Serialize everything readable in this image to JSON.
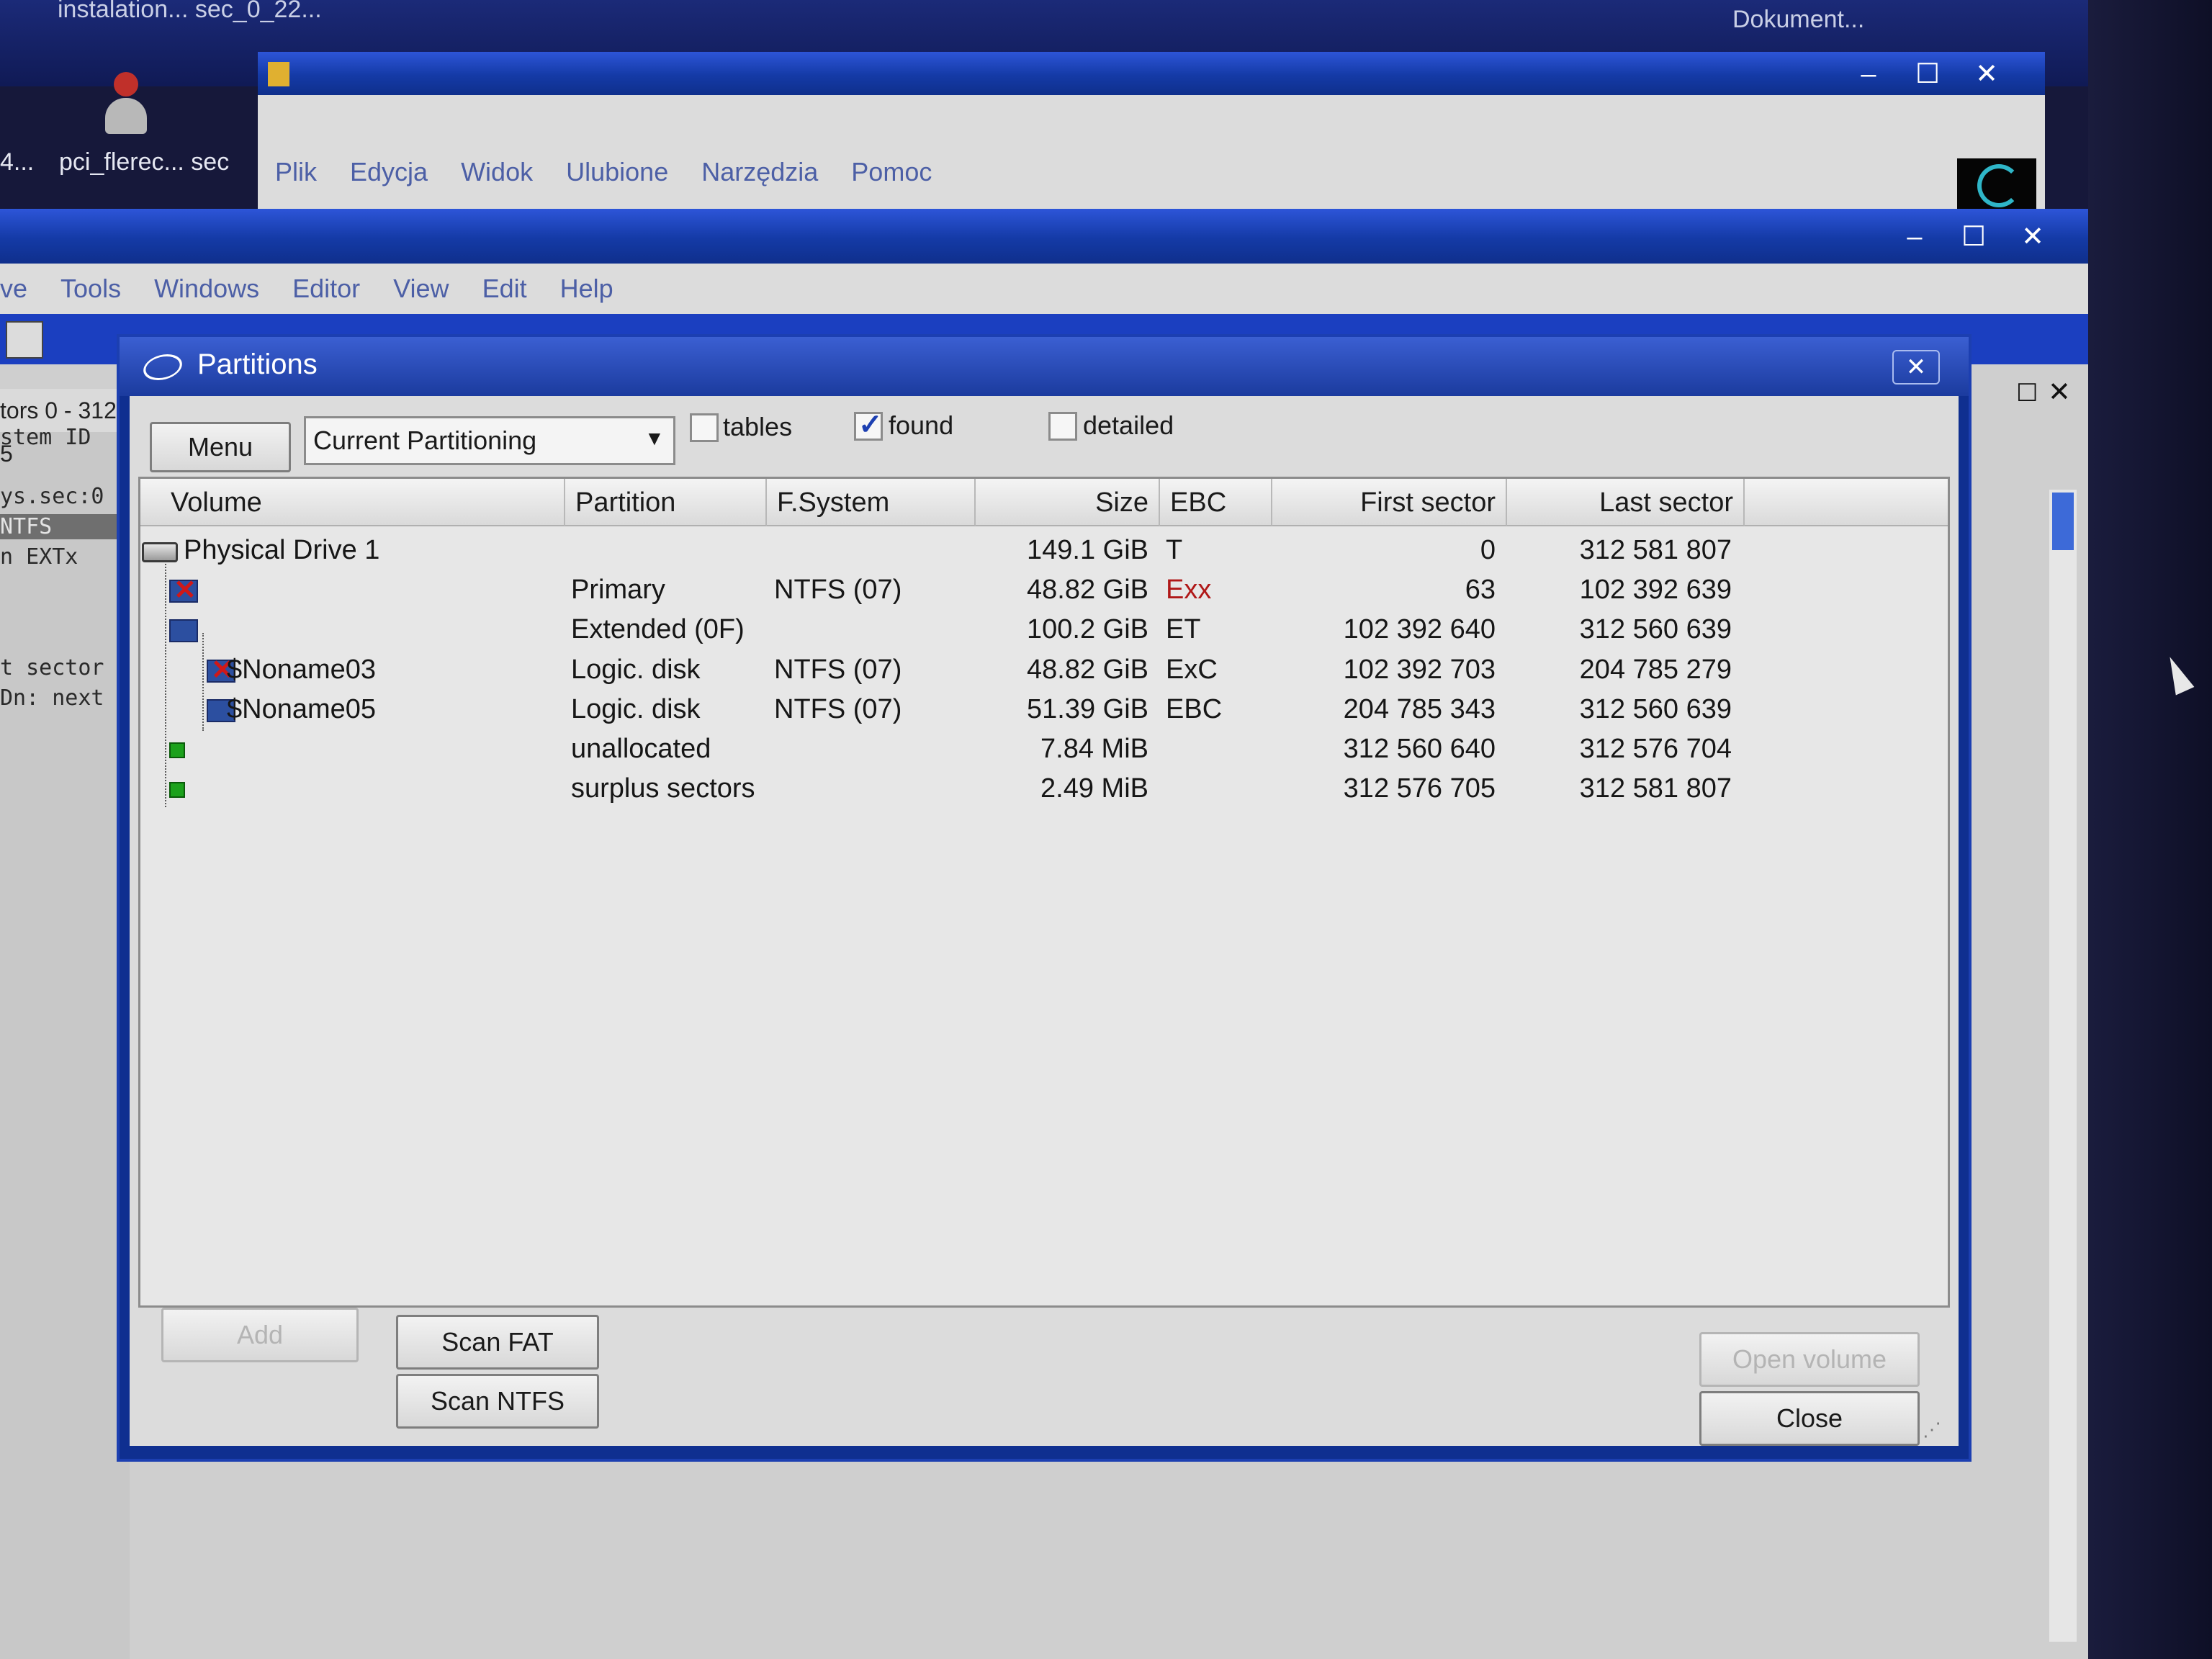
{
  "desktop": {
    "top_left_text": "instalation... sec_0_22...",
    "top_right_text": "Dokument...",
    "icon_caption": "pci_flerec... sec",
    "icon_caption_prefix": "4..."
  },
  "explorer": {
    "menu": [
      "Plik",
      "Edycja",
      "Widok",
      "Ulubione",
      "Narzędzia",
      "Pomoc"
    ]
  },
  "app": {
    "menu": [
      "ve",
      "Tools",
      "Windows",
      "Editor",
      "View",
      "Edit",
      "Help"
    ],
    "side_header": "tors 0 - 312 5",
    "side_lines": [
      "stem ID",
      "ys.sec:0",
      " NTFS",
      "n EXTx",
      "",
      "",
      "t sector",
      "Dn: next"
    ]
  },
  "dialog": {
    "title": "Partitions",
    "menu_button": "Menu",
    "dropdown_value": "Current Partitioning",
    "checkboxes": [
      {
        "label": "tables",
        "checked": false
      },
      {
        "label": "found",
        "checked": true
      },
      {
        "label": "detailed",
        "checked": false
      }
    ],
    "columns": [
      "Volume",
      "Partition",
      "F.System",
      "Size",
      "EBC",
      "First sector",
      "Last sector"
    ],
    "rows": [
      {
        "volume": "Physical Drive 1",
        "partition": "",
        "fs": "",
        "size": "149.1 GiB",
        "ebc": "T",
        "first": "0",
        "last": "312 581 807",
        "icon": "disk-icon",
        "ebc_red": false
      },
      {
        "volume": "",
        "partition": "Primary",
        "fs": "NTFS (07)",
        "size": "48.82 GiB",
        "ebc": "Exx",
        "first": "63",
        "last": "102 392 639",
        "icon": "partition-error-icon",
        "ebc_red": true
      },
      {
        "volume": "",
        "partition": "Extended  (0F)",
        "fs": "",
        "size": "100.2 GiB",
        "ebc": "ET",
        "first": "102 392 640",
        "last": "312 560 639",
        "icon": "extended-partition-icon",
        "ebc_red": false
      },
      {
        "volume": "$Noname03",
        "partition": "Logic. disk",
        "fs": "NTFS (07)",
        "size": "48.82 GiB",
        "ebc": "ExC",
        "first": "102 392 703",
        "last": "204 785 279",
        "icon": "partition-error-icon",
        "ebc_red": false
      },
      {
        "volume": "$Noname05",
        "partition": "Logic. disk",
        "fs": "NTFS (07)",
        "size": "51.39 GiB",
        "ebc": "EBC",
        "first": "204 785 343",
        "last": "312 560 639",
        "icon": "partition-icon",
        "ebc_red": false
      },
      {
        "volume": "",
        "partition": "unallocated",
        "fs": "",
        "size": "7.84 MiB",
        "ebc": "",
        "first": "312 560 640",
        "last": "312 576 704",
        "icon": "free-space-icon",
        "ebc_red": false
      },
      {
        "volume": "",
        "partition": "surplus sectors",
        "fs": "",
        "size": "2.49 MiB",
        "ebc": "",
        "first": "312 576 705",
        "last": "312 581 807",
        "icon": "free-space-icon",
        "ebc_red": false
      }
    ],
    "buttons": {
      "add": "Add",
      "scan_fat": "Scan FAT",
      "scan_ntfs": "Scan NTFS",
      "open_volume": "Open volume",
      "close": "Close"
    }
  }
}
